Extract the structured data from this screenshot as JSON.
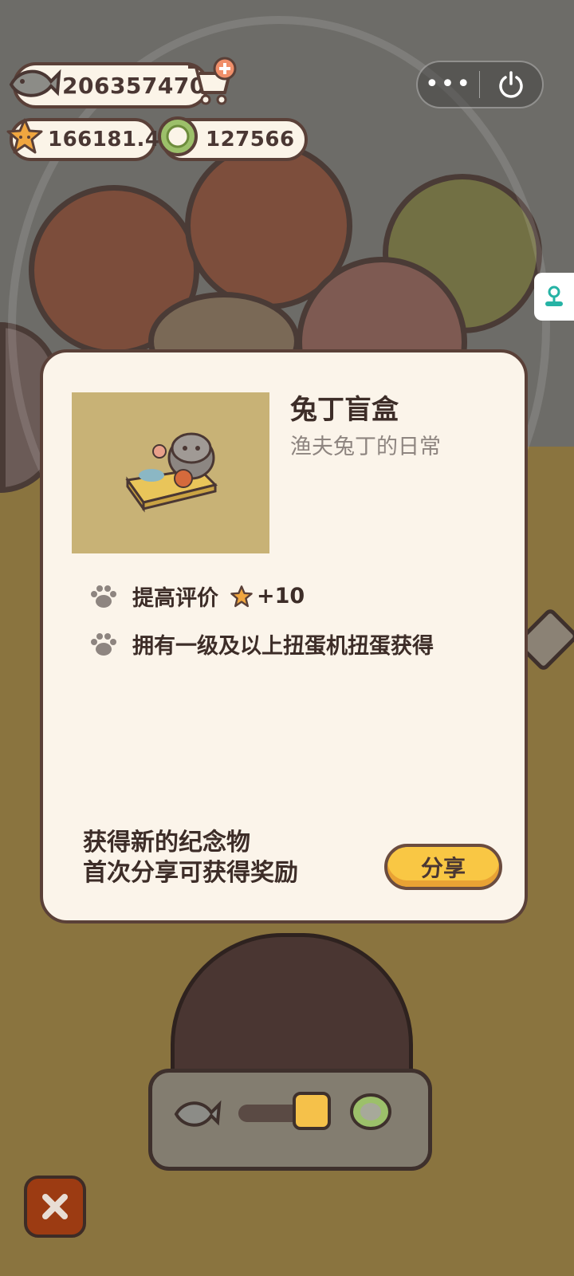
{
  "hud": {
    "fish_currency": "206357470",
    "star_rating": "166181.4",
    "coin_currency": "127566"
  },
  "capsule": {
    "more_label": "•••"
  },
  "modal": {
    "title": "兔丁盲盒",
    "subtitle": "渔夫兔丁的日常",
    "effect_label": "提高评价",
    "effect_value": "+10",
    "source_text": "拥有一级及以上扭蛋机扭蛋获得",
    "footer_line1": "获得新的纪念物",
    "footer_line2": "首次分享可获得奖励",
    "share_label": "分享"
  },
  "colors": {
    "accent_yellow": "#f9c744",
    "outline_brown": "#5a4038",
    "card_bg": "#fbf4ea",
    "close_red": "#9c3b12"
  },
  "icons": [
    "fish-icon",
    "shop-cart-icon",
    "star-icon",
    "coin-icon",
    "more-icon",
    "power-icon",
    "joystick-icon",
    "paw-icon",
    "close-icon"
  ]
}
